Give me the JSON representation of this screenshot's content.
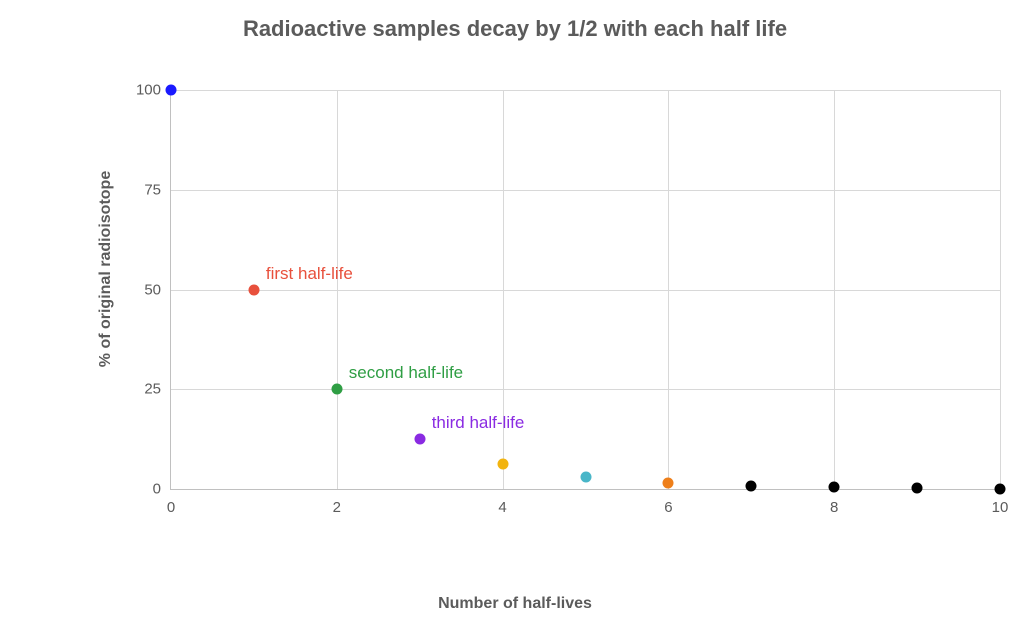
{
  "chart_data": {
    "type": "scatter",
    "title": "Radioactive samples decay by 1/2 with each half life",
    "xlabel": "Number of half-lives",
    "ylabel": "% of original radioisotope",
    "xlim": [
      0,
      10
    ],
    "ylim": [
      0,
      100
    ],
    "xticks": [
      0,
      2,
      4,
      6,
      8,
      10
    ],
    "yticks": [
      0,
      25,
      50,
      75,
      100
    ],
    "points": [
      {
        "x": 0,
        "y": 100.0,
        "color": "#1a1aff"
      },
      {
        "x": 1,
        "y": 50.0,
        "color": "#e8503c",
        "label": "first half-life",
        "label_color": "#e8503c"
      },
      {
        "x": 2,
        "y": 25.0,
        "color": "#2f9e44",
        "label": "second half-life",
        "label_color": "#2f9e44"
      },
      {
        "x": 3,
        "y": 12.5,
        "color": "#8a2be2",
        "label": "third half-life",
        "label_color": "#8a2be2"
      },
      {
        "x": 4,
        "y": 6.25,
        "color": "#f2b40f"
      },
      {
        "x": 5,
        "y": 3.125,
        "color": "#49b6c8"
      },
      {
        "x": 6,
        "y": 1.5625,
        "color": "#ee7f1a"
      },
      {
        "x": 7,
        "y": 0.78125,
        "color": "#000000"
      },
      {
        "x": 8,
        "y": 0.390625,
        "color": "#000000"
      },
      {
        "x": 9,
        "y": 0.1953125,
        "color": "#000000"
      },
      {
        "x": 10,
        "y": 0.09765625,
        "color": "#000000"
      }
    ]
  }
}
